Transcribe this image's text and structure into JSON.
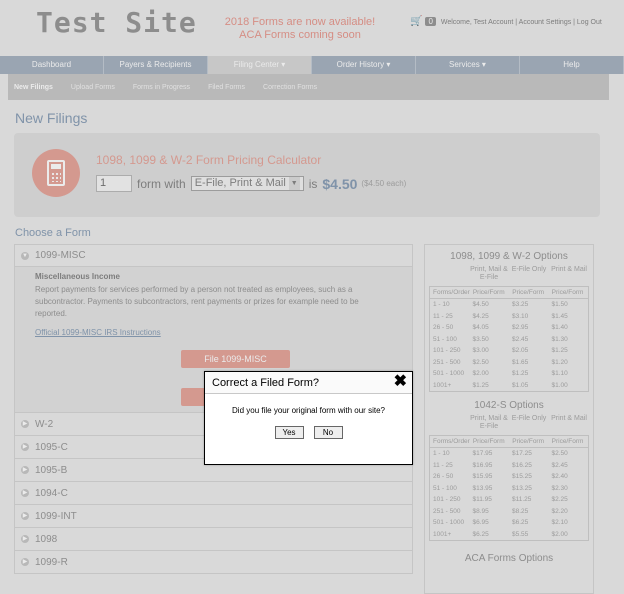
{
  "header": {
    "logo": "Test Site",
    "promo_line1": "2018 Forms are now available!",
    "promo_line2": "ACA Forms coming soon",
    "cart_count": "0",
    "account_links": "Welcome, Test Account | Account Settings | Log Out"
  },
  "nav": [
    {
      "label": "Dashboard"
    },
    {
      "label": "Payers & Recipients"
    },
    {
      "label": "Filing Center ▾"
    },
    {
      "label": "Order History ▾"
    },
    {
      "label": "Services ▾"
    },
    {
      "label": "Help"
    }
  ],
  "subnav": [
    {
      "label": "New Filings"
    },
    {
      "label": "Upload Forms"
    },
    {
      "label": "Forms in Progress"
    },
    {
      "label": "Filed Forms"
    },
    {
      "label": "Correction Forms"
    }
  ],
  "page_title": "New Filings",
  "calculator": {
    "title": "1098, 1099 & W-2 Form Pricing Calculator",
    "quantity": "1",
    "form_with": "form with",
    "option": "E-File, Print & Mail",
    "is": "is",
    "price": "$4.50",
    "each": "($4.50 each)"
  },
  "choose_label": "Choose a Form",
  "forms": {
    "open": {
      "label": "1099-MISC",
      "title": "Miscellaneous Income",
      "description": "Report payments for services performed by a person not treated as employees, such as a subcontractor. Payments to subcontractors, rent payments or prizes for example need to be reported.",
      "link": "Official 1099-MISC IRS Instructions",
      "file_button": "File 1099-MISC"
    },
    "items": [
      "W-2",
      "1095-C",
      "1095-B",
      "1094-C",
      "1099-INT",
      "1098",
      "1099-R"
    ]
  },
  "pricing": {
    "section1": {
      "title": "1098, 1099 & W-2 Options",
      "col_heads": [
        "",
        "Print, Mail & E-File",
        "E-File Only",
        "Print & Mail"
      ],
      "table_head": [
        "Forms/Order",
        "Price/Form",
        "Price/Form",
        "Price/Form"
      ],
      "rows": [
        [
          "1 - 10",
          "$4.50",
          "$3.25",
          "$1.50"
        ],
        [
          "11 - 25",
          "$4.25",
          "$3.10",
          "$1.45"
        ],
        [
          "26 - 50",
          "$4.05",
          "$2.95",
          "$1.40"
        ],
        [
          "51 - 100",
          "$3.50",
          "$2.45",
          "$1.30"
        ],
        [
          "101 - 250",
          "$3.00",
          "$2.05",
          "$1.25"
        ],
        [
          "251 - 500",
          "$2.50",
          "$1.65",
          "$1.20"
        ],
        [
          "501 - 1000",
          "$2.00",
          "$1.25",
          "$1.10"
        ],
        [
          "1001+",
          "$1.25",
          "$1.05",
          "$1.00"
        ]
      ]
    },
    "section2": {
      "title": "1042-S Options",
      "col_heads": [
        "",
        "Print, Mail & E-File",
        "E-File Only",
        "Print & Mail"
      ],
      "table_head": [
        "Forms/Order",
        "Price/Form",
        "Price/Form",
        "Price/Form"
      ],
      "rows": [
        [
          "1 - 10",
          "$17.95",
          "$17.25",
          "$2.50"
        ],
        [
          "11 - 25",
          "$16.95",
          "$16.25",
          "$2.45"
        ],
        [
          "26 - 50",
          "$15.95",
          "$15.25",
          "$2.40"
        ],
        [
          "51 - 100",
          "$13.95",
          "$13.25",
          "$2.30"
        ],
        [
          "101 - 250",
          "$11.95",
          "$11.25",
          "$2.25"
        ],
        [
          "251 - 500",
          "$8.95",
          "$8.25",
          "$2.20"
        ],
        [
          "501 - 1000",
          "$6.95",
          "$6.25",
          "$2.10"
        ],
        [
          "1001+",
          "$6.25",
          "$5.55",
          "$2.00"
        ]
      ]
    },
    "section3": {
      "title": "ACA Forms Options"
    }
  },
  "dialog": {
    "title": "Correct a Filed Form?",
    "close": "✖",
    "message": "Did you file your original form with our site?",
    "yes": "Yes",
    "no": "No"
  },
  "colors": {
    "accent": "#e6a69c",
    "nav": "#a8b4c2",
    "heading_blue": "#8ba0b8"
  }
}
